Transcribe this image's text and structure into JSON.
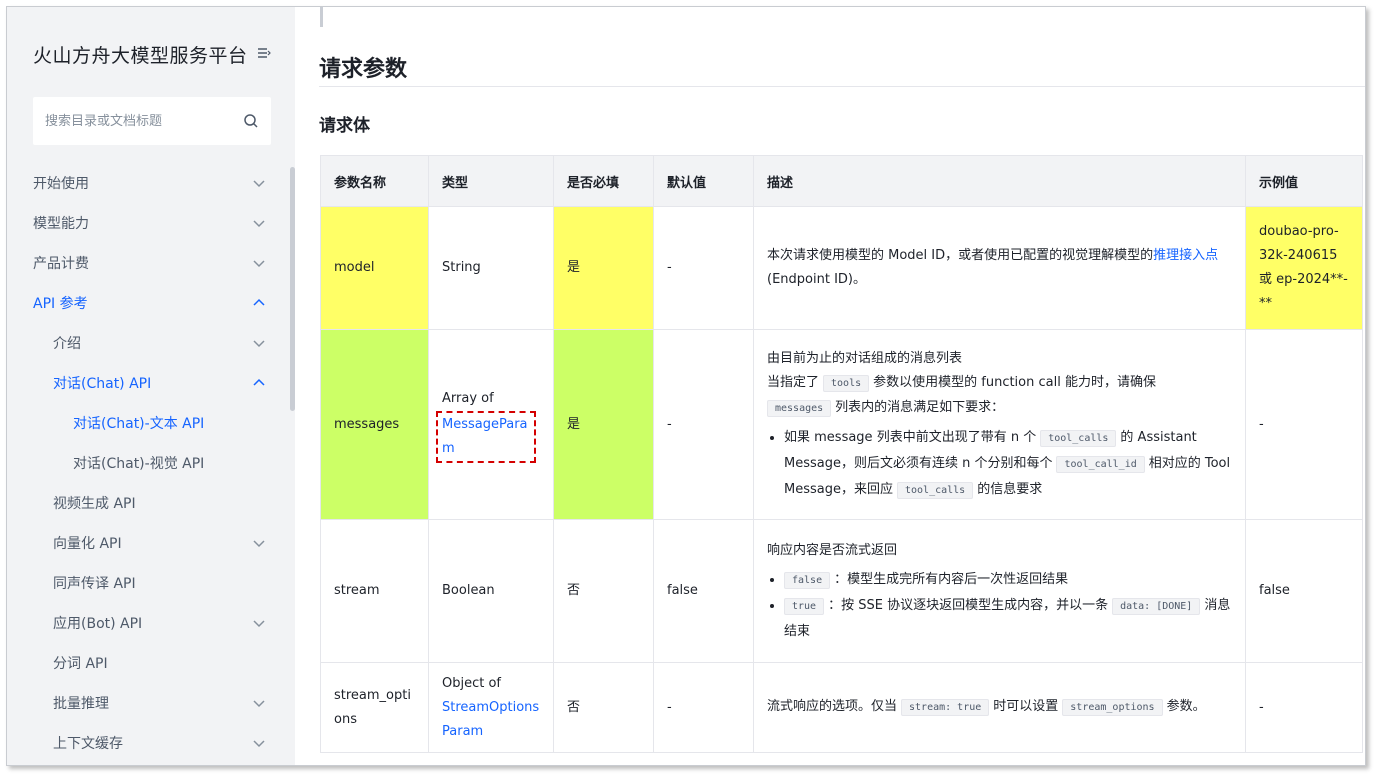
{
  "sidebar": {
    "brand": "火山方舟大模型服务平台",
    "search_placeholder": "搜索目录或文档标题",
    "items": [
      {
        "label": "开始使用"
      },
      {
        "label": "模型能力"
      },
      {
        "label": "产品计费"
      },
      {
        "label": "API 参考"
      },
      {
        "label": "介绍"
      },
      {
        "label": "对话(Chat) API"
      },
      {
        "label": "对话(Chat)-文本 API"
      },
      {
        "label": "对话(Chat)-视觉 API"
      },
      {
        "label": "视频生成 API"
      },
      {
        "label": "向量化 API"
      },
      {
        "label": "同声传译 API"
      },
      {
        "label": "应用(Bot) API"
      },
      {
        "label": "分词 API"
      },
      {
        "label": "批量推理"
      },
      {
        "label": "上下文缓存"
      }
    ]
  },
  "main": {
    "h2": "请求参数",
    "h3": "请求体",
    "table": {
      "headers": [
        "参数名称",
        "类型",
        "是否必填",
        "默认值",
        "描述",
        "示例值"
      ],
      "rows": [
        {
          "name": "model",
          "type_text": "String",
          "required": "是",
          "default": "-",
          "desc_pre": "本次请求使用模型的 Model ID，或者使用已配置的视觉理解模型的",
          "desc_link": "推理接入点",
          "desc_post": " (Endpoint ID)。",
          "example": "doubao-pro-32k-240615 或 ep-2024**-**"
        },
        {
          "name": "messages",
          "type_prefix": "Array of",
          "type_link": "MessageParam",
          "required": "是",
          "default": "-",
          "desc_line1": "由目前为止的对话组成的消息列表",
          "desc_line2_a": "当指定了",
          "code_tools": "tools",
          "desc_line2_b": "参数以使用模型的 function call 能力时，请确保",
          "code_messages": "messages",
          "desc_line3": "列表内的消息满足如下要求：",
          "bullet_a": "如果 message 列表中前文出现了带有 n 个",
          "code_tool_calls": "tool_calls",
          "bullet_b": "的 Assistant Message，则后文必须有连续 n 个分别和每个",
          "code_tool_call_id": "tool_call_id",
          "bullet_c": "相对应的 Tool Message，来回应",
          "code_tool_calls_2": "tool_calls",
          "bullet_d": "的信息要求",
          "example": "-"
        },
        {
          "name": "stream",
          "type_text": "Boolean",
          "required": "否",
          "default": "false",
          "desc_line1": "响应内容是否流式返回",
          "code_false": "false",
          "bullet1": "：模型生成完所有内容后一次性返回结果",
          "code_true": "true",
          "bullet2_a": "：按 SSE 协议逐块返回模型生成内容，并以一条",
          "code_done": "data: [DONE]",
          "bullet2_b": "消息结束",
          "example": "false"
        },
        {
          "name": "stream_options",
          "type_prefix": "Object of",
          "type_link": "StreamOptionsParam",
          "required": "否",
          "default": "-",
          "desc_a": "流式响应的选项。仅当",
          "code_stream_true": "stream: true",
          "desc_b": "时可以设置",
          "code_stream_options": "stream_options",
          "desc_c": "参数。",
          "example": "-"
        }
      ]
    }
  },
  "colors": {
    "accent": "#1664ff",
    "highlight_yellow": "#ffff66",
    "highlight_green": "#ccff66",
    "annotation_red": "#d40000",
    "sidebar_bg": "#f2f3f5"
  },
  "icons": {
    "menu": "menu-collapse-icon",
    "search": "search-icon",
    "expand": "chevron-down-icon",
    "collapse": "chevron-up-icon"
  }
}
